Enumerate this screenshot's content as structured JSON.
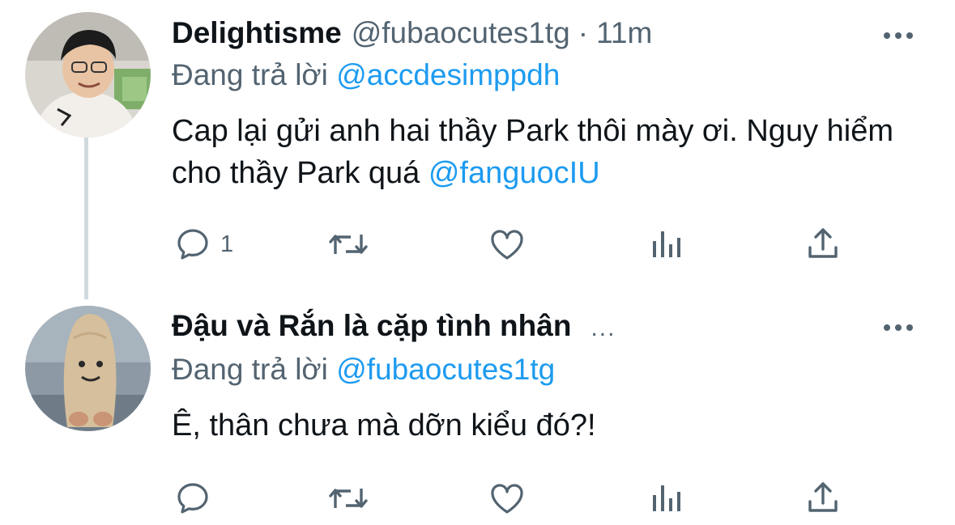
{
  "tweets": [
    {
      "display_name": "Delightisme",
      "handle": "@fubaocutes1tg",
      "separator": "·",
      "time": "11m",
      "reply_prefix": "Đang trả lời",
      "reply_to": "@accdesimppdh",
      "text_main": "Cap lại gửi anh hai thầy Park thôi mày ơi. Nguy hiểm cho thầy Park quá ",
      "text_mention": "@fanguocIU",
      "reply_count": "1",
      "icons": [
        "reply-icon",
        "retweet-icon",
        "like-icon",
        "views-icon",
        "share-icon",
        "more-icon"
      ]
    },
    {
      "display_name": "Đậu và Rắn là cặp tình nhân",
      "ellipsis": "...",
      "reply_prefix": "Đang trả lời",
      "reply_to": "@fubaocutes1tg",
      "text_main": "Ê, thân chưa mà dỡn kiểu đó?!",
      "reply_count": "",
      "icons": [
        "reply-icon",
        "retweet-icon",
        "like-icon",
        "views-icon",
        "share-icon",
        "more-icon"
      ]
    }
  ],
  "colors": {
    "text": "#0f1419",
    "secondary": "#536471",
    "link": "#1d9bf0",
    "thread_line": "#cfd9de"
  }
}
